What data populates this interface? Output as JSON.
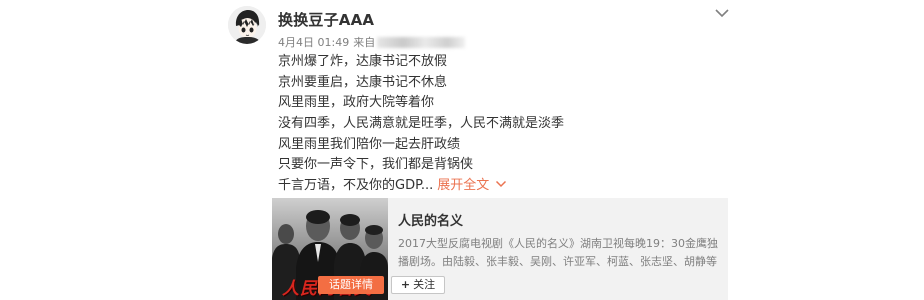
{
  "user": {
    "name": "换换豆子AAA",
    "time": "4月4日 01:49",
    "source_prefix": "来自"
  },
  "post": {
    "lines": [
      "京州爆了炸，达康书记不放假",
      "京州要重启，达康书记不休息",
      "风里雨里，政府大院等着你",
      "没有四季，人民满意就是旺季，人民不满就是淡季",
      "风里雨里我们陪你一起去肝政绩",
      "只要你一声令下，我们都是背锅侠",
      "千言万语，不及你的GDP..."
    ],
    "expand_label": "展开全文"
  },
  "card": {
    "title": "人民的名义",
    "description": "2017大型反腐电视剧《人民的名义》湖南卫视每晚19：30金鹰独播剧场。由陆毅、张丰毅、吴刚、许亚军、柯蓝、张志坚、胡静等",
    "poster_text": "人民的名义",
    "detail_button": "话题详情",
    "follow_button": "关注"
  },
  "colors": {
    "accent": "#eb7350",
    "button_orange": "#f36e43",
    "card_bg": "#f2f2f2",
    "poster_red": "#d8261e"
  },
  "icons": {
    "menu": "chevron-down-icon",
    "expand": "chevron-down-icon",
    "follow": "plus-icon"
  }
}
